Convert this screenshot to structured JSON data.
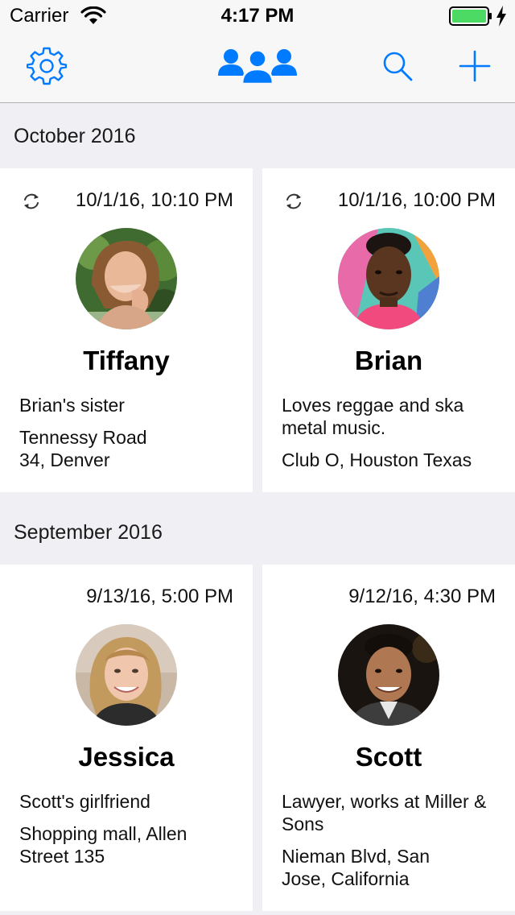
{
  "status_bar": {
    "carrier": "Carrier",
    "time": "4:17 PM"
  },
  "nav_bar": {
    "icons": [
      "gear-icon",
      "people-icon",
      "search-icon",
      "plus-icon"
    ],
    "accent_color": "#007aff"
  },
  "sections": [
    {
      "title": "October 2016",
      "cards": [
        {
          "date": "10/1/16, 10:10 PM",
          "synced": true,
          "name": "Tiffany",
          "description": "Brian's sister",
          "location": "Tennessy Road 34, Denver"
        },
        {
          "date": "10/1/16, 10:00 PM",
          "synced": true,
          "name": "Brian",
          "description": "Loves reggae and ska metal music.",
          "location": "Club O, Houston Texas"
        }
      ]
    },
    {
      "title": "September 2016",
      "cards": [
        {
          "date": "9/13/16, 5:00 PM",
          "synced": false,
          "name": "Jessica",
          "description": "Scott's girlfriend",
          "location": "Shopping mall, Allen Street 135"
        },
        {
          "date": "9/12/16, 4:30 PM",
          "synced": false,
          "name": "Scott",
          "description": "Lawyer, works at Miller & Sons",
          "location": "Nieman Blvd, San Jose, California"
        }
      ]
    }
  ]
}
